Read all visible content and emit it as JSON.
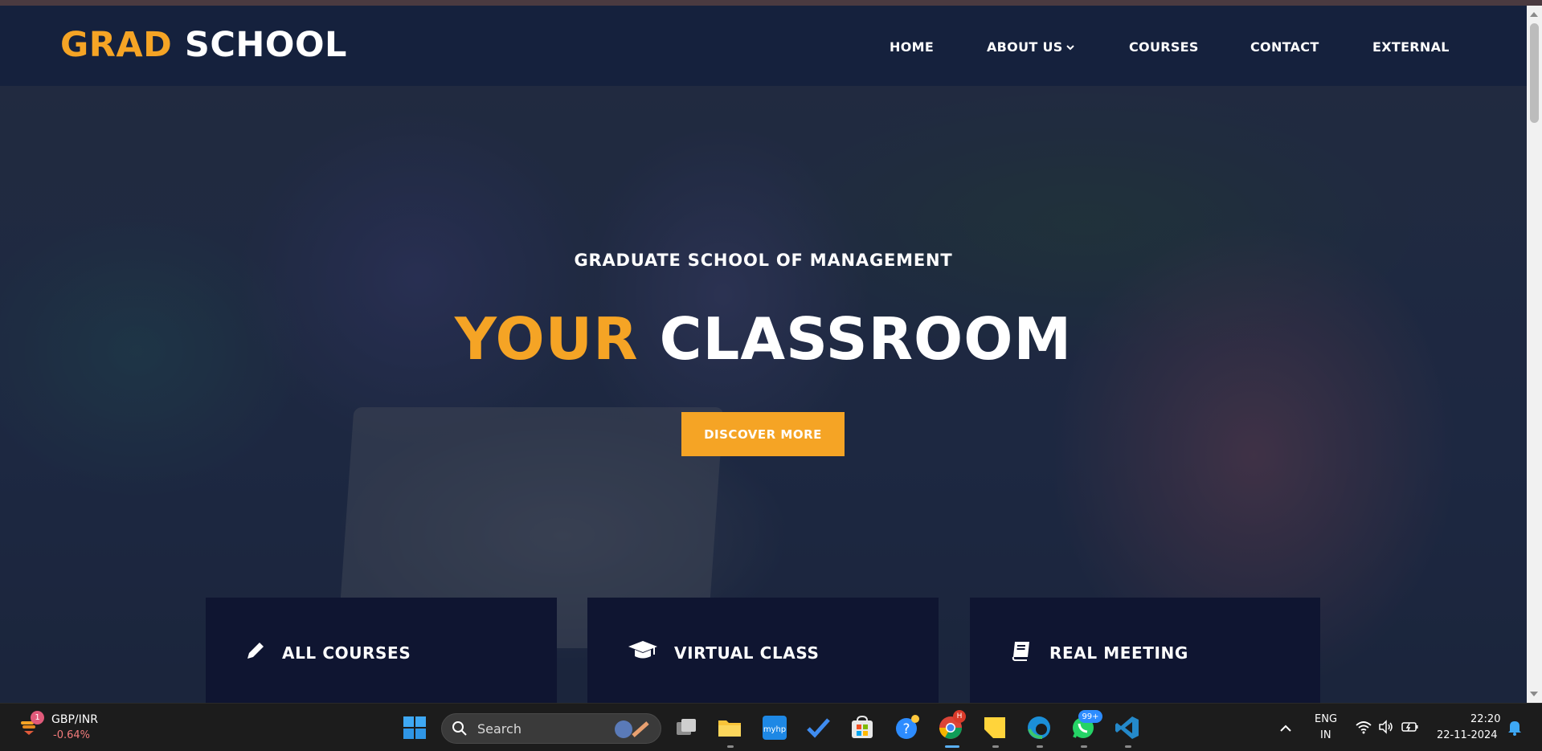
{
  "brand": {
    "part1": "GRAD",
    "part2": "SCHOOL"
  },
  "nav": [
    {
      "label": "HOME"
    },
    {
      "label": "ABOUT US"
    },
    {
      "label": "COURSES"
    },
    {
      "label": "CONTACT"
    },
    {
      "label": "EXTERNAL"
    }
  ],
  "hero": {
    "subtitle": "GRADUATE SCHOOL OF MANAGEMENT",
    "title_accent": "YOUR",
    "title_rest": "CLASSROOM",
    "button": "DISCOVER MORE"
  },
  "features": [
    {
      "label": "ALL COURSES",
      "icon": "pencil-icon"
    },
    {
      "label": "VIRTUAL CLASS",
      "icon": "graduation-cap-icon"
    },
    {
      "label": "REAL MEETING",
      "icon": "book-icon"
    }
  ],
  "colors": {
    "accent": "#f5a425",
    "nav_bg": "#15213d",
    "feature_bg": "#0f1531"
  },
  "taskbar": {
    "ticker_badge": "1",
    "ticker_symbol": "GBP/INR",
    "ticker_change": "-0.64%",
    "search_placeholder": "Search",
    "whatsapp_badge": "99+",
    "chrome_badge": "H",
    "language_line1": "ENG",
    "language_line2": "IN",
    "time": "22:20",
    "date": "22-11-2024"
  }
}
